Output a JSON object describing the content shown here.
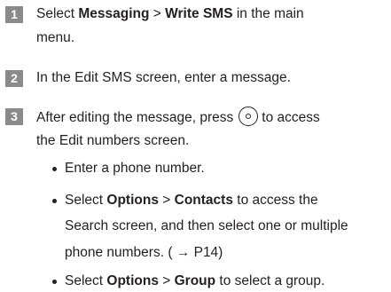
{
  "steps": [
    {
      "number": "1",
      "lines": [
        {
          "pre": "Select ",
          "b1": "Messaging",
          "mid": " > ",
          "b2": "Write SMS",
          "post": " in the main"
        },
        {
          "text": "menu."
        }
      ]
    },
    {
      "number": "2",
      "lines": [
        {
          "text": "In the Edit SMS screen, enter a message."
        }
      ]
    },
    {
      "number": "3",
      "lines": [
        {
          "pre": "After editing the message, press",
          "icon": "center-key-icon",
          "post": "to access"
        },
        {
          "text": "the Edit numbers screen."
        }
      ],
      "bullets": [
        {
          "lines": [
            {
              "text": "Enter a phone number."
            }
          ]
        },
        {
          "lines": [
            {
              "pre": "Select ",
              "b1": "Options",
              "mid": " > ",
              "b2": "Contacts",
              "post": " to access the"
            },
            {
              "text": "Search screen, and then select one or multiple"
            },
            {
              "text": "phone numbers. ( → P14)"
            }
          ]
        },
        {
          "lines": [
            {
              "pre": "Select ",
              "b1": "Options",
              "mid": " > ",
              "b2": "Group",
              "post": " to select a group."
            }
          ]
        }
      ]
    }
  ]
}
